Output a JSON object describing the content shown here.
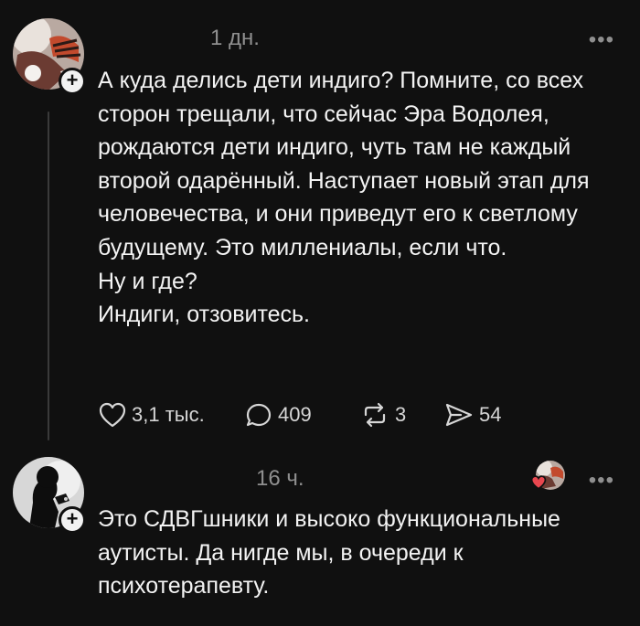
{
  "comments": [
    {
      "time": "1 дн.",
      "more": "•••",
      "text": "А куда делись дети индиго? Помните, со всех сторон трещали, что сейчас Эра Водолея, рождаются дети индиго, чуть там не каждый второй одарённый. Наступает новый этап для человечества, и они приведут его к светлому будущему. Это миллениалы, если что.\nНу и где?\nИндиги, отзовитесь.",
      "actions": {
        "likes": "3,1 тыс.",
        "replies": "409",
        "reposts": "3",
        "shares": "54"
      }
    },
    {
      "time": "16 ч.",
      "more": "•••",
      "text": "Это СДВГшники и высоко функциональные аутисты. Да нигде мы, в очереди к психотерапевту."
    }
  ],
  "icons": {
    "like": "heart-icon",
    "reply": "comment-bubble-icon",
    "repost": "repost-arrows-icon",
    "share": "send-arrow-icon",
    "follow": "plus-icon",
    "more": "ellipsis-icon"
  },
  "colors": {
    "background": "#101010",
    "text": "#f3f3f3",
    "muted": "#8f8f8f",
    "heart": "#e8474f"
  }
}
